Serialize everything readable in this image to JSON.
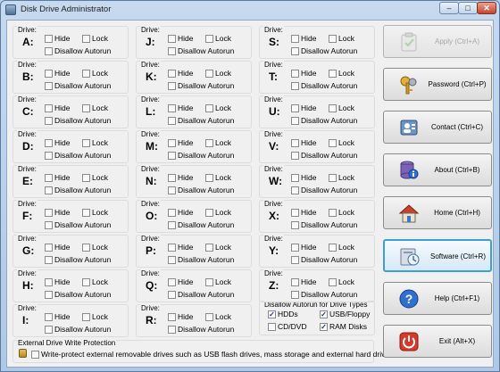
{
  "window": {
    "title": "Disk Drive Administrator"
  },
  "titlebar_buttons": {
    "minimize": "–",
    "maximize": "□",
    "close": "✕"
  },
  "group_title": "Drive:",
  "checkbox_labels": {
    "hide": "Hide",
    "lock": "Lock",
    "disallow": "Disallow Autorun"
  },
  "drives": {
    "A": "A:",
    "B": "B:",
    "C": "C:",
    "D": "D:",
    "E": "E:",
    "F": "F:",
    "G": "G:",
    "H": "H:",
    "I": "I:",
    "J": "J:",
    "K": "K:",
    "L": "L:",
    "M": "M:",
    "N": "N:",
    "O": "O:",
    "P": "P:",
    "Q": "Q:",
    "R": "R:",
    "S": "S:",
    "T": "T:",
    "U": "U:",
    "V": "V:",
    "W": "W:",
    "X": "X:",
    "Y": "Y:",
    "Z": "Z:"
  },
  "autorun_types": {
    "title": "Disallow Autorun for Drive Types",
    "hdds": {
      "label": "HDDs",
      "checked": true
    },
    "usb": {
      "label": "USB/Floppy",
      "checked": true
    },
    "cddvd": {
      "label": "CD/DVD",
      "checked": false
    },
    "ram": {
      "label": "RAM Disks",
      "checked": true
    }
  },
  "write_protection": {
    "title": "External Drive Write Protection",
    "label": "Write-protect external removable drives such as USB flash drives, mass storage and external hard drives",
    "checked": false
  },
  "actions": {
    "apply": {
      "label": "Apply (Ctrl+A)",
      "icon": "clipboard-check-icon",
      "enabled": false
    },
    "password": {
      "label": "Password (Ctrl+P)",
      "icon": "keys-icon"
    },
    "contact": {
      "label": "Contact (Ctrl+C)",
      "icon": "contact-icon"
    },
    "about": {
      "label": "About (Ctrl+B)",
      "icon": "database-info-icon"
    },
    "home": {
      "label": "Home (Ctrl+H)",
      "icon": "home-icon"
    },
    "software": {
      "label": "Software (Ctrl+R)",
      "icon": "software-icon",
      "selected": true
    },
    "help": {
      "label": "Help (Ctrl+F1)",
      "icon": "help-icon"
    },
    "exit": {
      "label": "Exit (Alt+X)",
      "icon": "power-icon"
    }
  },
  "colors": {
    "selected_border": "#3ca0d8",
    "window_frame": "#b9d1ea",
    "client_bg": "#f0f0f0"
  }
}
